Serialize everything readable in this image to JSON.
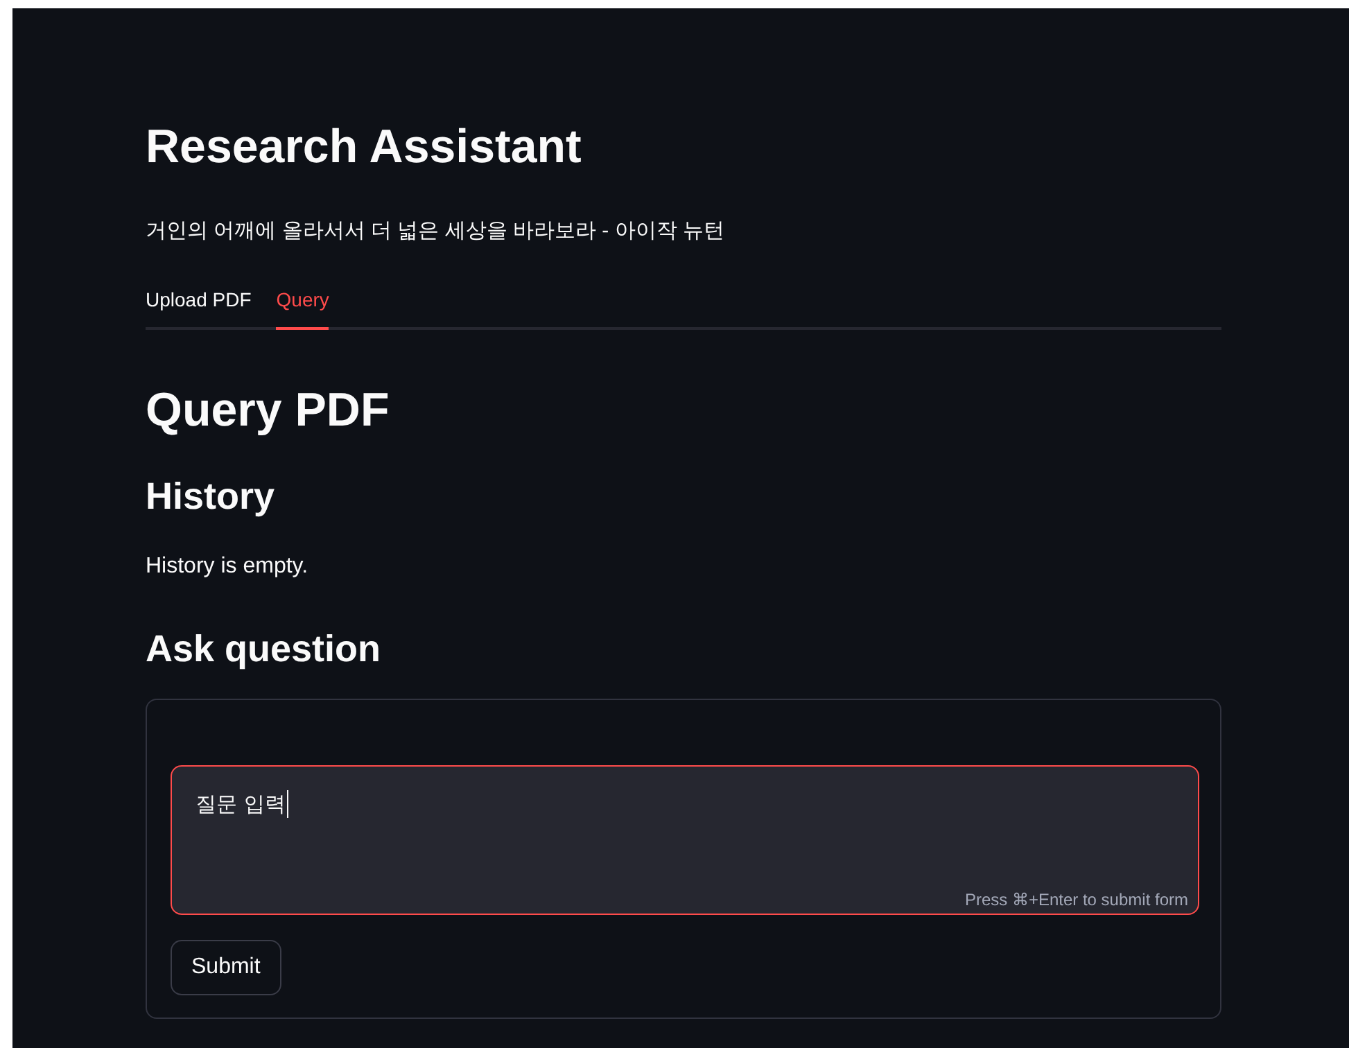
{
  "header": {
    "title": "Research Assistant",
    "subtitle": "거인의 어깨에 올라서서 더 넓은 세상을 바라보라 - 아이작 뉴턴"
  },
  "tabs": [
    {
      "label": "Upload PDF",
      "selected": false
    },
    {
      "label": "Query",
      "selected": true
    }
  ],
  "page_title": "Query PDF",
  "history": {
    "heading": "History",
    "message": "History is empty."
  },
  "ask": {
    "heading": "Ask question",
    "question_field": {
      "value": "질문 입력",
      "focused": true,
      "hint": "Press ⌘+Enter to submit form"
    },
    "submit_button": "Submit"
  }
}
